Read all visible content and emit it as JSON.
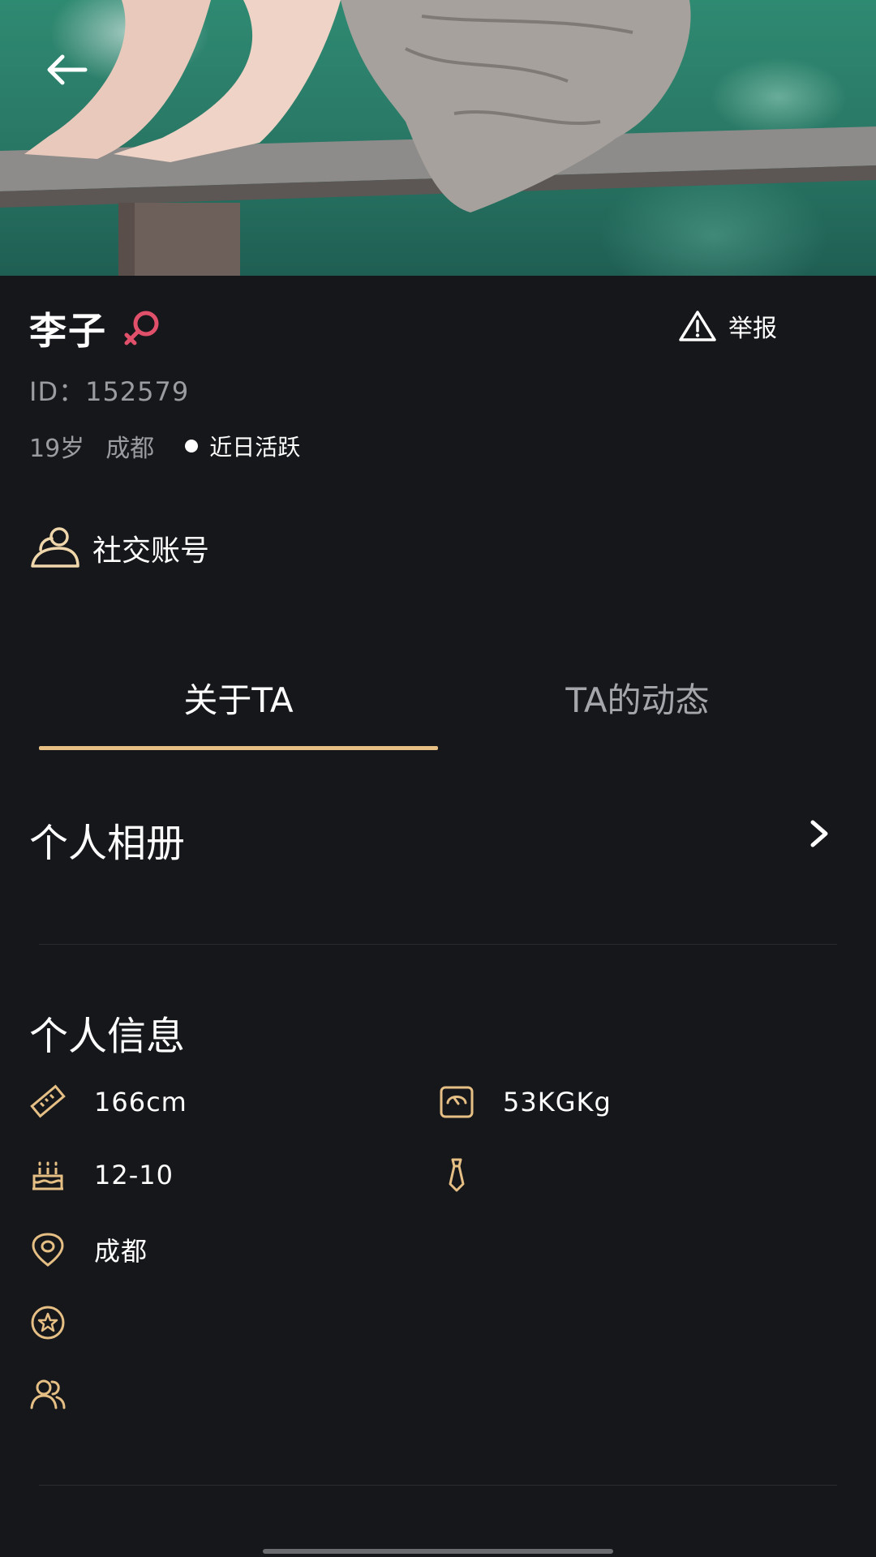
{
  "header": {
    "back_icon": "arrow-left-icon"
  },
  "profile": {
    "name": "李子",
    "gender_icon": "female-symbol-icon",
    "id_text": "ID：152579",
    "age": "19岁",
    "city": "成都",
    "status": "近日活跃"
  },
  "report": {
    "label": "举报",
    "icon": "warning-triangle-icon"
  },
  "social": {
    "label": "社交账号",
    "icon": "user-icon"
  },
  "tabs": [
    {
      "label": "关于TA",
      "active": true
    },
    {
      "label": "TA的动态",
      "active": false
    }
  ],
  "album": {
    "title": "个人相册",
    "icon": "chevron-right-icon"
  },
  "info": {
    "title": "个人信息",
    "height": "166cm",
    "weight": "53KGKg",
    "birthday": "12-10",
    "city": "成都"
  },
  "colors": {
    "accent": "#e6bf85",
    "background": "#16171b",
    "gender": "#e0506a"
  }
}
